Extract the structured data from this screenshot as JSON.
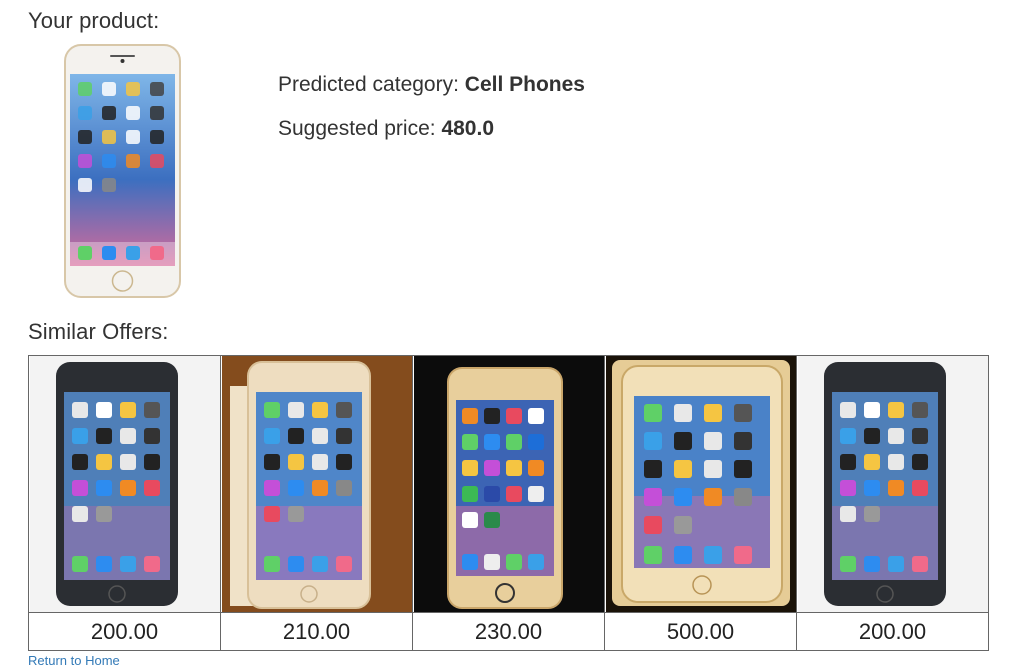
{
  "product": {
    "heading": "Your product:",
    "image_icon": "iphone-gold-photo",
    "category_label": "Predicted category:",
    "category_value": "Cell Phones",
    "price_label": "Suggested price:",
    "price_value": "480.0"
  },
  "similar": {
    "heading": "Similar Offers:",
    "offers": [
      {
        "price": "200.00",
        "image_icon": "iphone-space-gray-photo"
      },
      {
        "price": "210.00",
        "image_icon": "iphone-silver-in-box-photo"
      },
      {
        "price": "230.00",
        "image_icon": "iphone-gold-photo"
      },
      {
        "price": "500.00",
        "image_icon": "iphone-gold-in-box-photo"
      },
      {
        "price": "200.00",
        "image_icon": "iphone-space-gray-photo"
      }
    ]
  },
  "footer": {
    "return_link": "Return to Home"
  },
  "colors": {
    "link": "#337ab7",
    "text": "#333333",
    "border": "#666666"
  }
}
